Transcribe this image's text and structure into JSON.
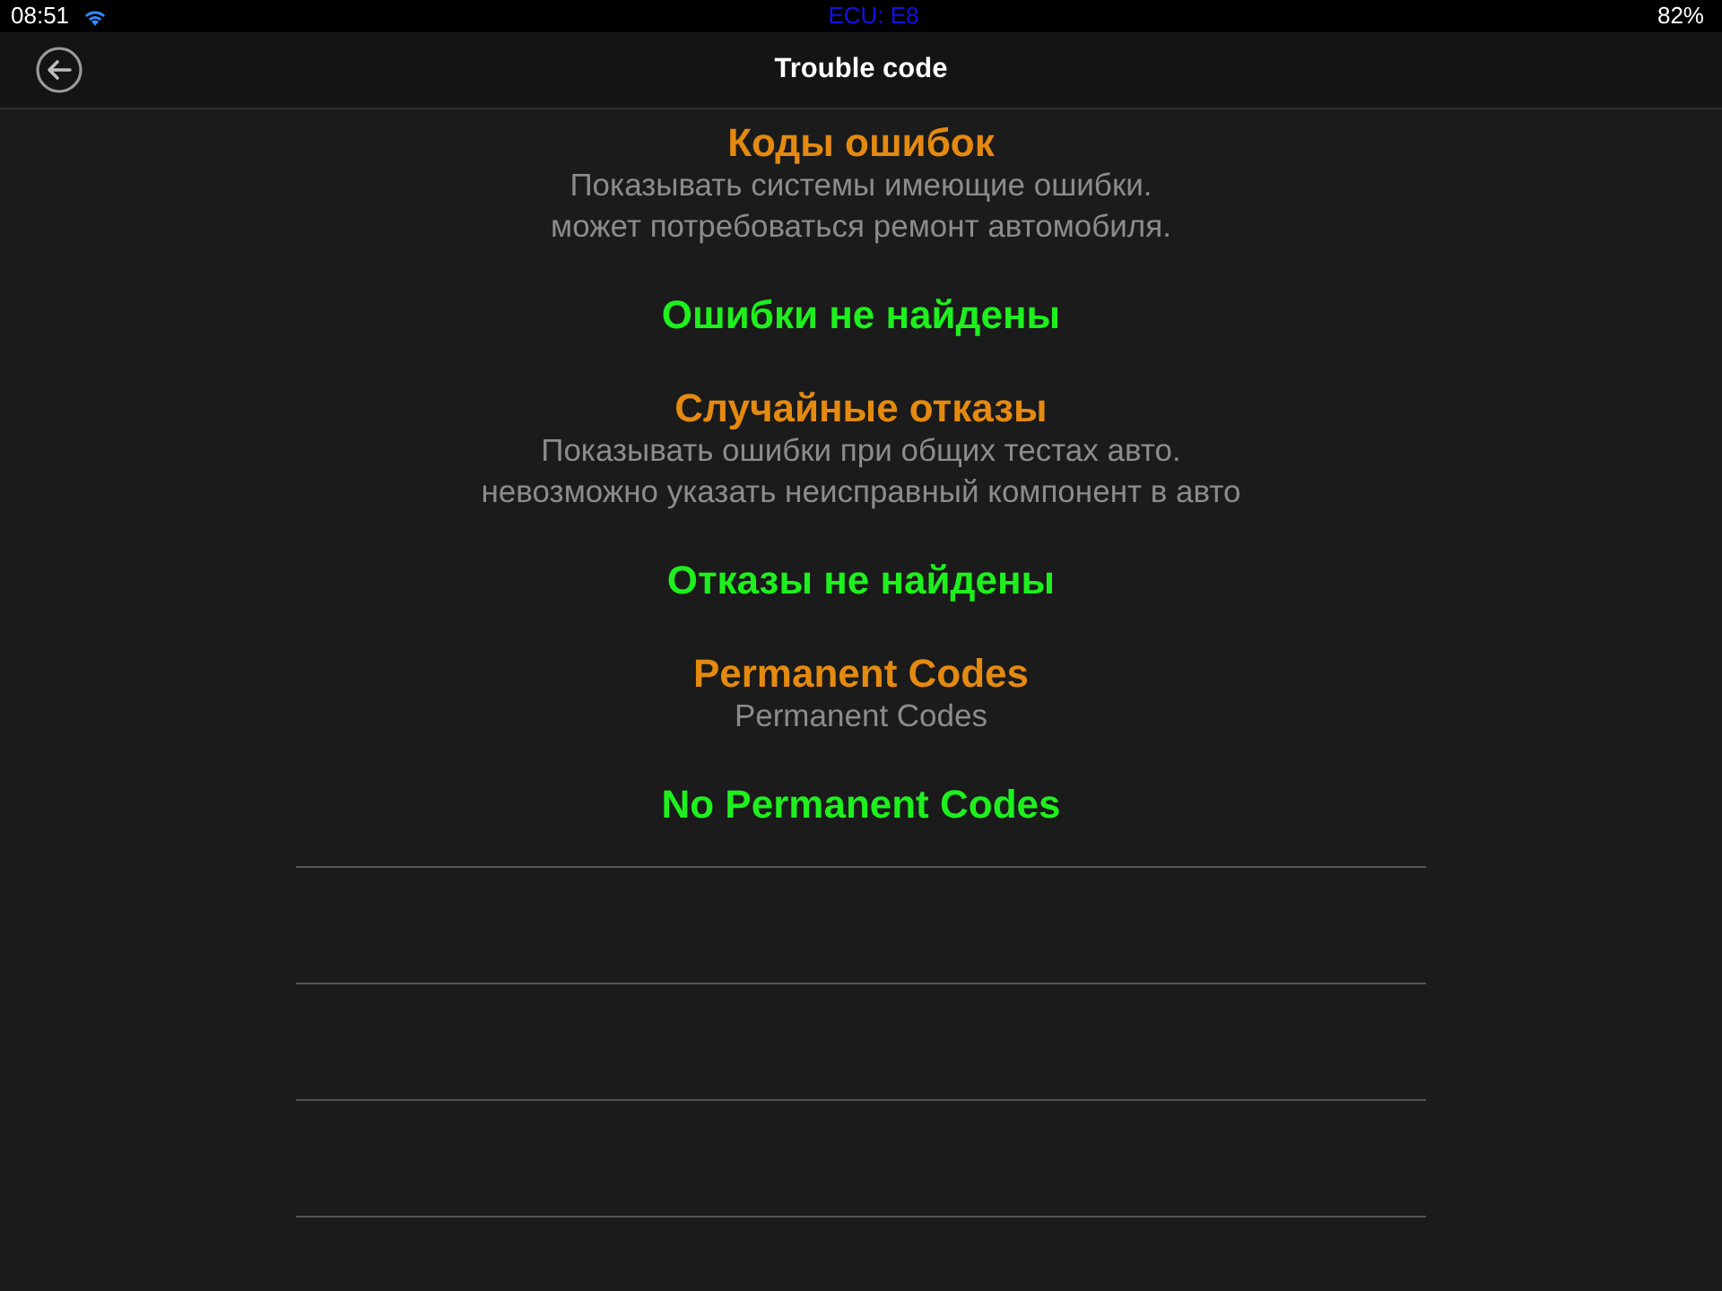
{
  "status_bar": {
    "time": "08:51",
    "center_text": "ECU: E8",
    "battery": "82%"
  },
  "nav_bar": {
    "title": "Trouble code"
  },
  "sections": [
    {
      "title": "Коды ошибок",
      "description": "Показывать системы имеющие ошибки.\nможет потребоваться ремонт автомобиля.",
      "result": "Ошибки не найдены"
    },
    {
      "title": "Случайные отказы",
      "description": "Показывать ошибки при общих тестах авто.\nневозможно указать неисправный компонент в авто",
      "result": "Отказы не найдены"
    },
    {
      "title": "Permanent Codes",
      "description": "Permanent Codes",
      "result": "No Permanent Codes"
    }
  ]
}
